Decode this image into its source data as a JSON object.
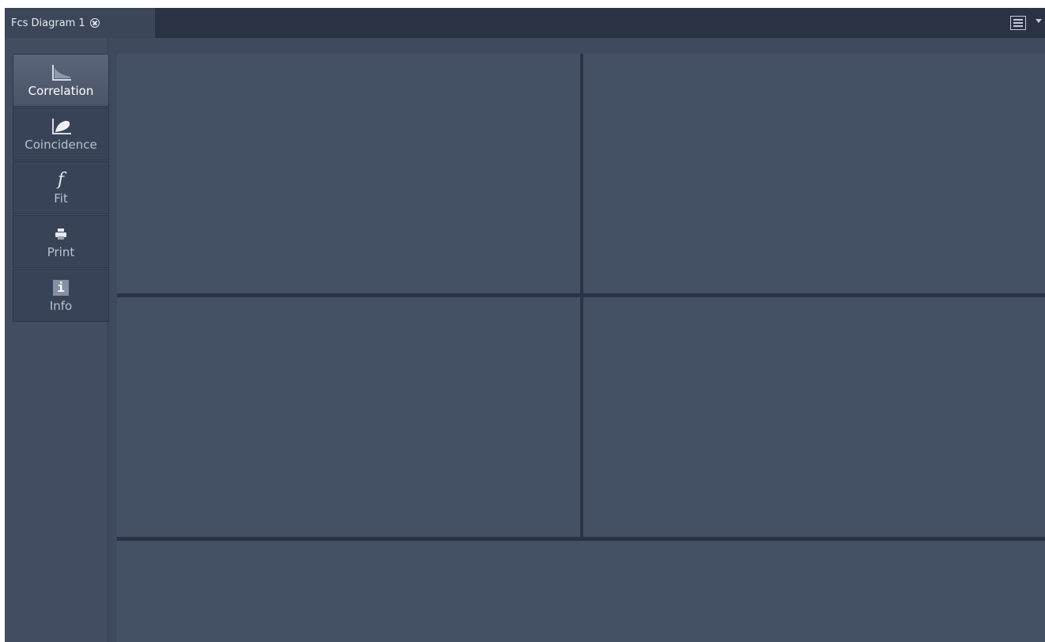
{
  "tab": {
    "label": "Fcs Diagram 1",
    "close_icon": "close-circle-icon"
  },
  "toolbar": {
    "layout_icon": "layout-list-icon",
    "dropdown_icon": "chevron-down-icon"
  },
  "sidebar": {
    "items": [
      {
        "label": "Correlation",
        "icon": "correlation-chart-icon",
        "active": true
      },
      {
        "label": "Coincidence",
        "icon": "coincidence-chart-icon",
        "active": false
      },
      {
        "label": "Fit",
        "icon": "function-icon",
        "glyph": "f",
        "active": false
      },
      {
        "label": "Print",
        "icon": "printer-icon",
        "active": false
      },
      {
        "label": "Info",
        "icon": "info-icon",
        "glyph": "i",
        "active": false
      }
    ]
  },
  "colors": {
    "background": "#404a5e",
    "tabbar": "#2a3244",
    "divider": "#2b3446",
    "active_button": "#5b6579"
  }
}
